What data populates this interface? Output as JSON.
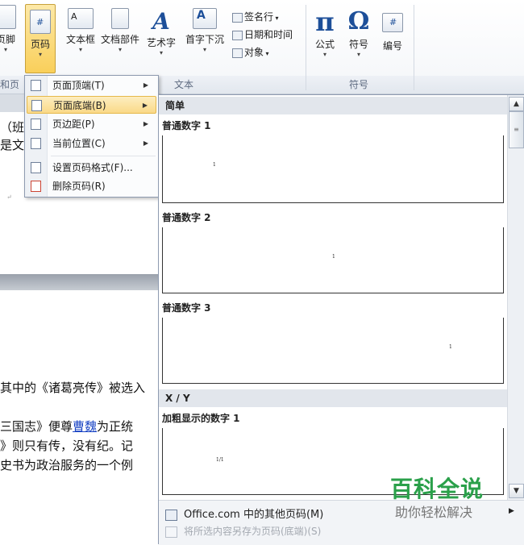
{
  "ribbon": {
    "buttons": {
      "footer": "页脚",
      "page_number": "页码",
      "text_box": "文本框",
      "quick_parts": "文档部件",
      "wordart": "艺术字",
      "drop_cap": "首字下沉",
      "equation": "公式",
      "symbol": "符号",
      "number": "编号"
    },
    "small_commands": {
      "signature_line": "签名行",
      "date_time": "日期和时间",
      "object": "对象"
    },
    "groups": {
      "header_footer": "和页",
      "text": "文本",
      "symbols": "符号"
    },
    "glyphs": {
      "equation": "π",
      "symbol": "Ω",
      "number": "#",
      "wordart": "A"
    }
  },
  "page_number_menu": {
    "items": [
      {
        "label": "页面顶端(T)",
        "has_submenu": true
      },
      {
        "label": "页面底端(B)",
        "has_submenu": true,
        "highlighted": true
      },
      {
        "label": "页边距(P)",
        "has_submenu": true
      },
      {
        "label": "当前位置(C)",
        "has_submenu": true
      },
      {
        "label": "设置页码格式(F)...",
        "has_submenu": false
      },
      {
        "label": "删除页码(R)",
        "has_submenu": false
      }
    ]
  },
  "gallery": {
    "categories": {
      "simple": "简单",
      "xy": "X / Y"
    },
    "tiles": [
      {
        "name": "普通数字 1",
        "sample": "1"
      },
      {
        "name": "普通数字 2",
        "sample": "1"
      },
      {
        "name": "普通数字 3",
        "sample": "1"
      },
      {
        "name": "加粗显示的数字 1",
        "sample": "1/1"
      }
    ],
    "footer": {
      "more_online": "Office.com 中的其他页码(M)",
      "save_selection": "将所选内容另存为页码(底端)(S)"
    }
  },
  "document": {
    "lines": [
      "（班",
      "是文",
      "其中的《诸葛亮传》被选入",
      "三国志》便尊",
      "曹魏",
      "为正统",
      "》则只有传，没有纪。记",
      "史书为政治服务的一个例"
    ]
  },
  "watermark": {
    "title": "百科全说",
    "subtitle": "助你轻松解决"
  },
  "colors": {
    "highlight": "#fad988",
    "link": "#1a44c4",
    "watermark": "#2aa04a"
  }
}
